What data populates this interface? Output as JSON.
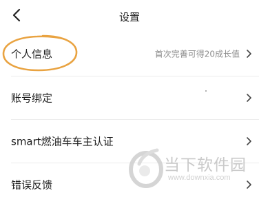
{
  "header": {
    "title": "设置",
    "back_icon": "chevron-left-icon"
  },
  "settings": {
    "items": [
      {
        "label": "个人信息",
        "hint": "首次完善可得20成长值"
      },
      {
        "label": "账号绑定"
      },
      {
        "label": "smart燃油车车主认证"
      },
      {
        "label": "错误反馈"
      }
    ]
  },
  "annotation": {
    "color": "#e9a341"
  },
  "watermark": {
    "brand": "当下软件园",
    "url": "www.downxia.com"
  }
}
